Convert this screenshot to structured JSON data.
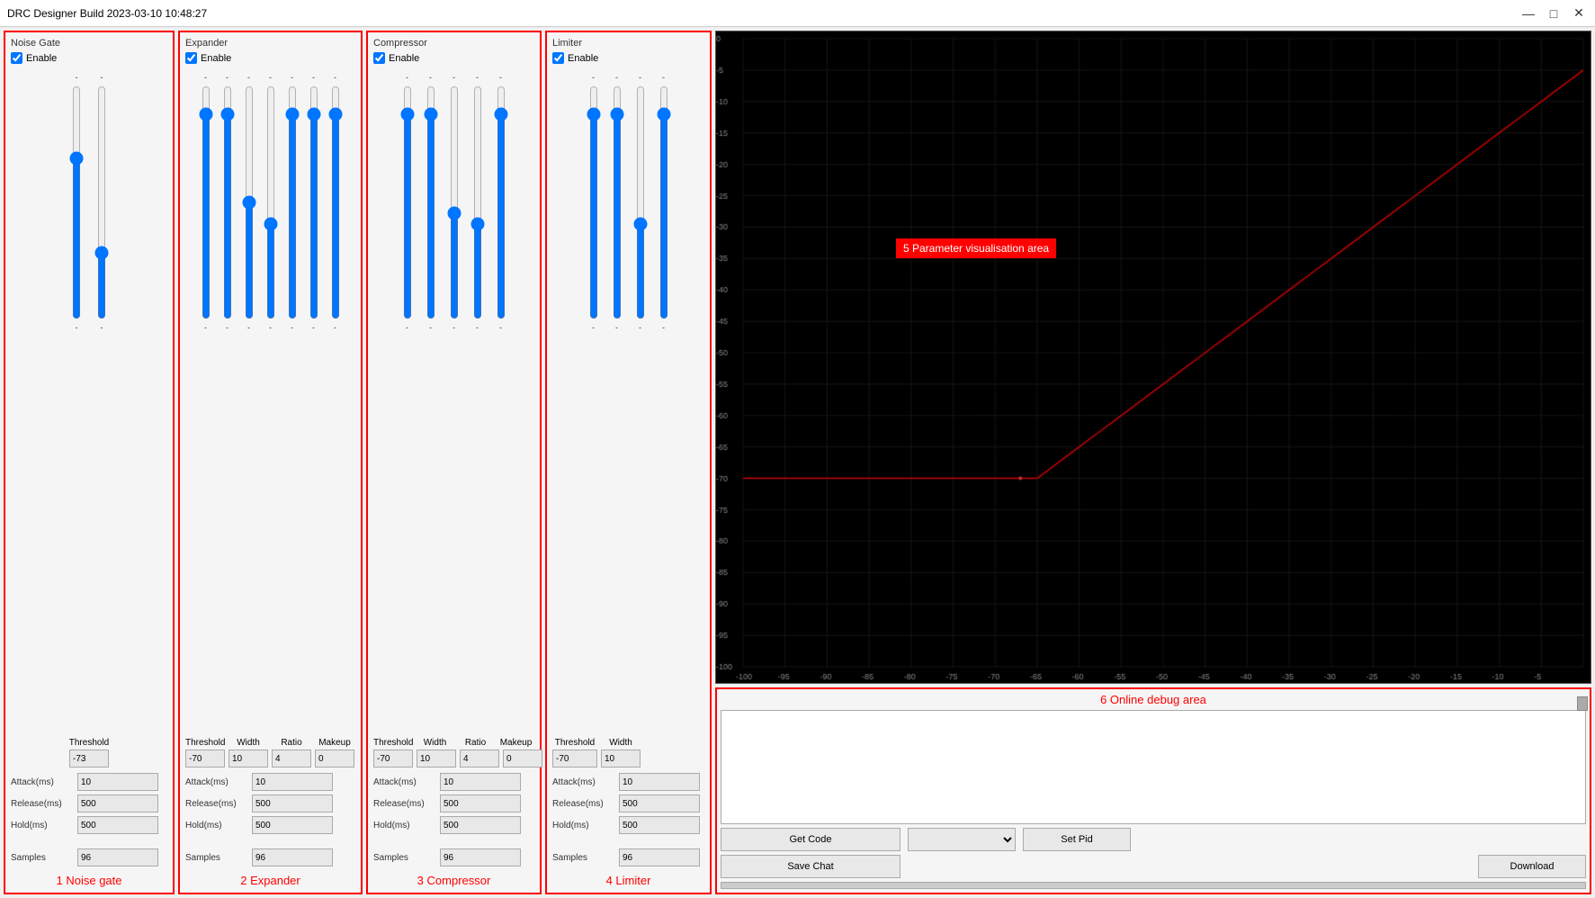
{
  "app": {
    "title": "DRC Designer  Build 2023-03-10 10:48:27",
    "min_label": "—",
    "max_label": "□",
    "close_label": "✕"
  },
  "noise_gate": {
    "section_title": "Noise Gate",
    "panel_label": "1 Noise gate",
    "enable_label": "Enable",
    "enable_checked": true,
    "slider1_top": "-",
    "slider1_bottom": "-",
    "slider2_top": "-",
    "slider2_bottom": "-",
    "threshold_label": "Threshold",
    "threshold_value": "-73",
    "attack_label": "Attack(ms)",
    "attack_value": "10",
    "release_label": "Release(ms)",
    "release_value": "500",
    "hold_label": "Hold(ms)",
    "hold_value": "500",
    "samples_label": "Samples",
    "samples_value": "96"
  },
  "expander": {
    "section_title": "Expander",
    "panel_label": "2 Expander",
    "enable_label": "Enable",
    "enable_checked": true,
    "threshold_label": "Threshold",
    "threshold_value": "-70",
    "width_label": "Width",
    "width_value": "10",
    "ratio_label": "Ratio",
    "ratio_value": "4",
    "makeup_label": "Makeup",
    "makeup_value": "0",
    "attack_label": "Attack(ms)",
    "attack_value": "10",
    "release_label": "Release(ms)",
    "release_value": "500",
    "hold_label": "Hold(ms)",
    "hold_value": "500",
    "samples_label": "Samples",
    "samples_value": "96"
  },
  "compressor": {
    "section_title": "Compressor",
    "panel_label": "3 Compressor",
    "enable_label": "Enable",
    "enable_checked": true,
    "threshold_label": "Threshold",
    "threshold_value": "-70",
    "width_label": "Width",
    "width_value": "10",
    "ratio_label": "Ratio",
    "ratio_value": "4",
    "makeup_label": "Makeup",
    "makeup_value": "0",
    "attack_label": "Attack(ms)",
    "attack_value": "10",
    "release_label": "Release(ms)",
    "release_value": "500",
    "hold_label": "Hold(ms)",
    "hold_value": "500",
    "samples_label": "Samples",
    "samples_value": "96"
  },
  "limiter": {
    "section_title": "Limiter",
    "panel_label": "4 Limiter",
    "enable_label": "Enable",
    "enable_checked": true,
    "threshold_label": "Threshold",
    "threshold_value": "-70",
    "width_label": "Width",
    "width_value": "10",
    "attack_label": "Attack(ms)",
    "attack_value": "10",
    "release_label": "Release(ms)",
    "release_value": "500",
    "hold_label": "Hold(ms)",
    "hold_value": "500",
    "samples_label": "Samples",
    "samples_value": "96"
  },
  "chart": {
    "tooltip": "5 Parameter visualisation area",
    "y_labels": [
      "0",
      "-5",
      "-10",
      "-15",
      "-20",
      "-25",
      "-30",
      "-35",
      "-40",
      "-45",
      "-50",
      "-55",
      "-60",
      "-65",
      "-70",
      "-75",
      "-80",
      "-85",
      "-90",
      "-95",
      "-100"
    ],
    "x_labels": [
      "-100",
      "-95",
      "-90",
      "-85",
      "-80",
      "-75",
      "-70",
      "-65",
      "-60",
      "-55",
      "-50",
      "-45",
      "-40",
      "-35",
      "-30",
      "-25",
      "-20",
      "-15",
      "-10",
      "-5"
    ]
  },
  "debug": {
    "panel_label": "6 Online debug area",
    "get_code_label": "Get Code",
    "save_chat_label": "Save Chat",
    "set_pid_label": "Set Pid",
    "download_label": "Download",
    "dropdown_placeholder": "",
    "textarea_content": ""
  }
}
